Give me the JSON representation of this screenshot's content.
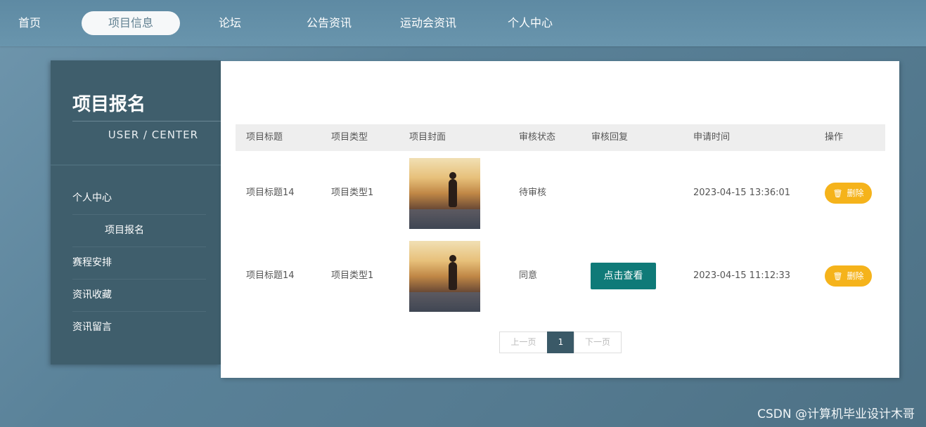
{
  "nav": {
    "items": [
      {
        "label": "首页"
      },
      {
        "label": "项目信息"
      },
      {
        "label": "论坛"
      },
      {
        "label": "公告资讯"
      },
      {
        "label": "运动会资讯"
      },
      {
        "label": "个人中心"
      }
    ],
    "active": "项目信息"
  },
  "sidebar": {
    "title": "项目报名",
    "subtitle": "USER / CENTER",
    "items": [
      {
        "label": "个人中心"
      },
      {
        "label": "项目报名"
      },
      {
        "label": "赛程安排"
      },
      {
        "label": "资讯收藏"
      },
      {
        "label": "资讯留言"
      }
    ]
  },
  "table": {
    "headers": [
      "项目标题",
      "项目类型",
      "项目封面",
      "审核状态",
      "审核回复",
      "申请时间",
      "操作"
    ],
    "rows": [
      {
        "title": "项目标题14",
        "type": "项目类型1",
        "cover": "runner-photo",
        "status": "待审核",
        "reply": "",
        "time": "2023-04-15 13:36:01",
        "delete": "删除"
      },
      {
        "title": "项目标题14",
        "type": "项目类型1",
        "cover": "runner-photo",
        "status": "同意",
        "reply": "点击查看",
        "time": "2023-04-15 11:12:33",
        "delete": "删除"
      }
    ]
  },
  "pager": {
    "prev": "上一页",
    "current": "1",
    "next": "下一页"
  },
  "watermark": "CSDN @计算机毕业设计木哥",
  "colors": {
    "accent": "#0f7a78",
    "delete": "#f5b31b",
    "sidebar": "#3f5e6c"
  }
}
